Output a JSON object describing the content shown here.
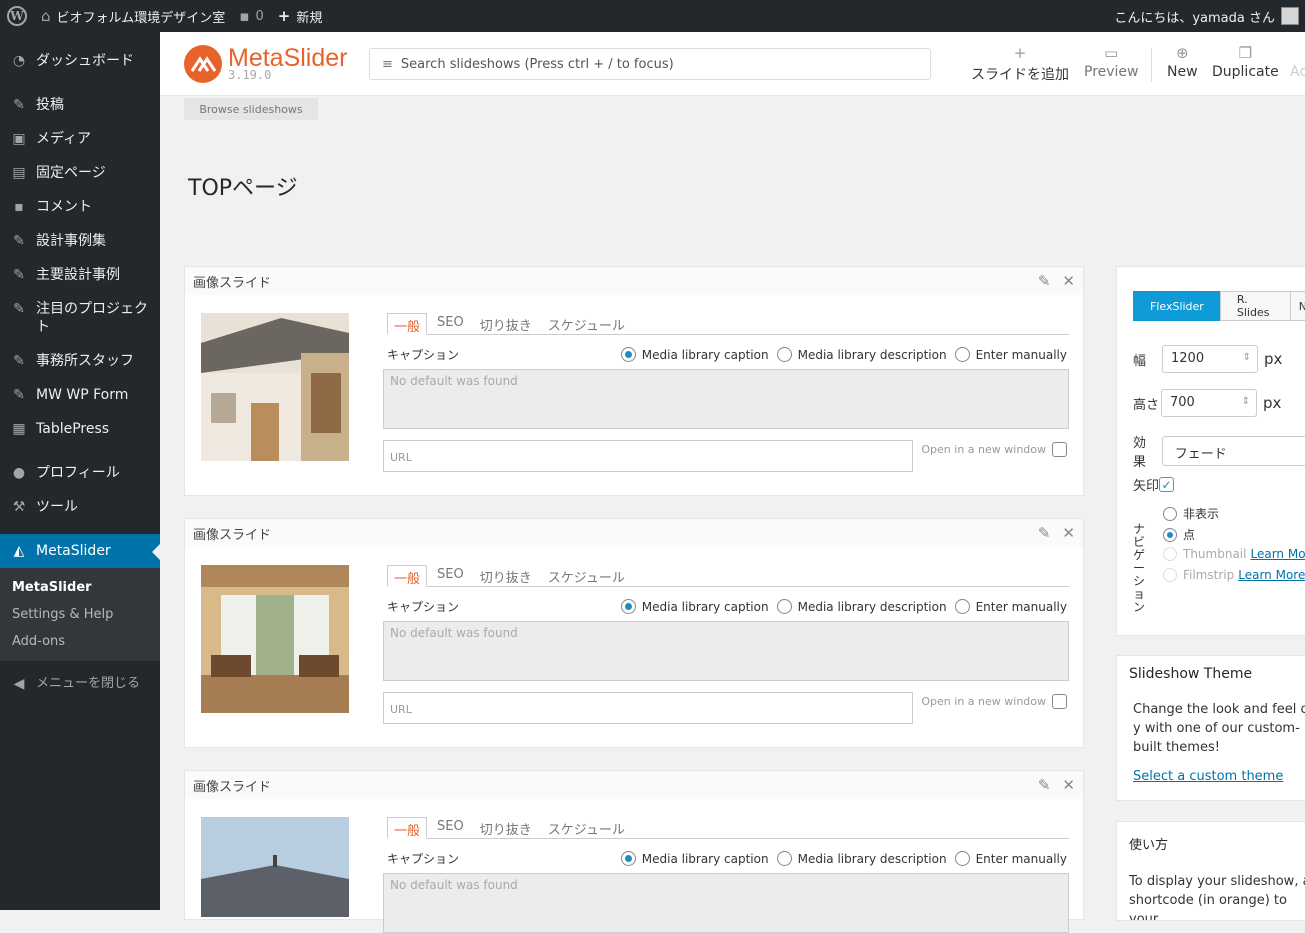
{
  "adminbar": {
    "site_name": "ビオフォルム環境デザイン室",
    "comments_count": "0",
    "new_label": "新規",
    "greeting": "こんにちは、yamada さん"
  },
  "sidebar": {
    "items": [
      {
        "label": "ダッシュボード",
        "icon": "dashboard-icon"
      },
      {
        "label": "投稿",
        "icon": "pin-icon"
      },
      {
        "label": "メディア",
        "icon": "media-icon"
      },
      {
        "label": "固定ページ",
        "icon": "page-icon"
      },
      {
        "label": "コメント",
        "icon": "comment-icon"
      },
      {
        "label": "設計事例集",
        "icon": "pin-icon"
      },
      {
        "label": "主要設計事例",
        "icon": "pin-icon"
      },
      {
        "label": "注目のプロジェクト",
        "icon": "pin-icon"
      },
      {
        "label": "事務所スタッフ",
        "icon": "pin-icon"
      },
      {
        "label": "MW WP Form",
        "icon": "pin-icon"
      },
      {
        "label": "TablePress",
        "icon": "table-icon"
      },
      {
        "label": "プロフィール",
        "icon": "user-icon"
      },
      {
        "label": "ツール",
        "icon": "wrench-icon"
      },
      {
        "label": "MetaSlider",
        "icon": "metaslider-icon"
      }
    ],
    "submenu": [
      "MetaSlider",
      "Settings & Help",
      "Add-ons"
    ],
    "collapse_label": "メニューを閉じる"
  },
  "topbar": {
    "brand": "MetaSlider",
    "version": "3.19.0",
    "search_placeholder": "Search slideshows (Press ctrl + / to focus)",
    "buttons": [
      {
        "label": "スライドを追加",
        "icon": "plus-icon"
      },
      {
        "label": "Preview",
        "icon": "video-icon"
      },
      {
        "label": "New",
        "icon": "plus-circle-icon"
      },
      {
        "label": "Duplicate",
        "icon": "duplicate-icon"
      },
      {
        "label": "Ac"
      }
    ]
  },
  "browse_label": "Browse slideshows",
  "page_title": "TOPページ",
  "slide_common": {
    "header": "画像スライド",
    "tabs": [
      "一般",
      "SEO",
      "切り抜き",
      "スケジュール"
    ],
    "caption_label": "キャプション",
    "radio_options": [
      "Media library caption",
      "Media library description",
      "Enter manually"
    ],
    "caption_placeholder": "No default was found",
    "url_placeholder": "URL",
    "new_window_label": "Open in a new window"
  },
  "settings": {
    "tabs": [
      "FlexSlider",
      "R. Slides",
      "N"
    ],
    "width_label": "幅",
    "width_value": "1200",
    "height_label": "高さ",
    "height_value": "700",
    "unit": "px",
    "effect_label": "効果",
    "effect_value": "フェード",
    "arrows_label": "矢印",
    "nav_label": "ナビゲーション",
    "nav_options": [
      {
        "label": "非表示"
      },
      {
        "label": "点"
      },
      {
        "label": "Thumbnail",
        "link": "Learn Mo"
      },
      {
        "label": "Filmstrip",
        "link": "Learn More"
      }
    ]
  },
  "theme_panel": {
    "title": "Slideshow Theme",
    "text": "Change the look and feel of y with one of our custom-built themes!",
    "link": "Select a custom theme"
  },
  "usage_panel": {
    "title": "使い方",
    "text": "To display your slideshow, ad shortcode (in orange) to your"
  },
  "colors": {
    "accent": "#e8622c",
    "admin_blue": "#0073aa",
    "flexslider_tab": "#0e9bd8"
  }
}
